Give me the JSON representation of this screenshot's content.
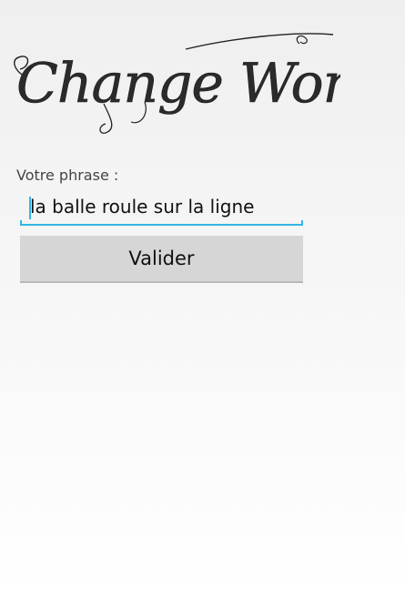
{
  "app": {
    "logo_text": "Change Words"
  },
  "form": {
    "label": "Votre phrase :",
    "phrase_value": "la balle roule sur la ligne",
    "submit_label": "Valider"
  },
  "colors": {
    "accent": "#33b5e5",
    "button_bg": "#d6d6d6"
  }
}
